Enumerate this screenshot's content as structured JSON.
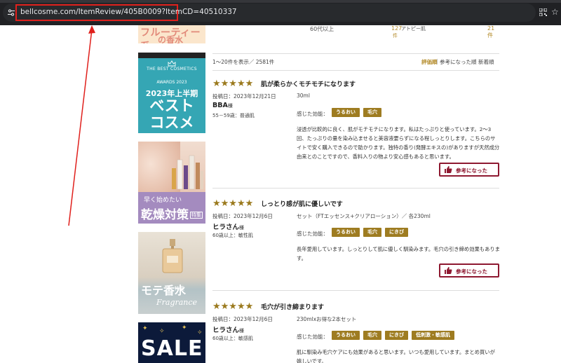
{
  "browser": {
    "url": "bellcosme.com/ItemReview/405B0009?ItemCD=40510337"
  },
  "banners": {
    "fruity": {
      "line1": "フルーティー系",
      "line2": "の香水"
    },
    "awards": {
      "line1": "THE BEST COSMETICS",
      "line2": "AWARDS 2023",
      "line3": "2023年上半期",
      "line4": "ベスト",
      "line5": "コスメ"
    },
    "dry": {
      "line1": "早く始めたい",
      "line2": "乾燥対策",
      "badge": "特集"
    },
    "perfume": {
      "line1": "モテ香水",
      "line2": "特集",
      "line3": "Fragrance"
    },
    "sale": {
      "line1": "SALE"
    }
  },
  "summary_row": {
    "age": "60代以上",
    "count1": "127",
    "count1_unit": "件",
    "skin": "アトピー肌",
    "count2": "21件"
  },
  "listing": {
    "pager": "1〜20件を表示／ 2581件",
    "sort_options": [
      "評価順",
      "参考になった順",
      "新着順"
    ],
    "active_sort": 0
  },
  "reviews": [
    {
      "stars": "★★★★★",
      "title": "肌が柔らかくモチモチになります",
      "date": "投稿日：2023年12月21日",
      "name": "BBA",
      "honorific": "様",
      "attributes": "55－59歳：普通肌",
      "product": "30ml",
      "effect_label": "感じた効能：",
      "tags": [
        "うるおい",
        "毛穴"
      ],
      "body": "浸透が比較的に良く、肌がモチモチになります。私はたっぷりと使っています。2〜3回、たっぷりの量を染み込ませると美容液要らずになる程しっとりします。こちらのサイトで安く購入できるので助かります。独特の香り(発酵エキスの)がありますが天然成分由来とのことですので、香料入りの物より安心感もあると思います。",
      "helpful": "参考になった"
    },
    {
      "stars": "★★★★★",
      "title": "しっとり感が肌に優しいです",
      "date": "投稿日：2023年12月6日",
      "name": "ヒラさん",
      "honorific": "様",
      "attributes": "60歳以上：敏性肌",
      "product": "セット（FTエッセンス+クリアローション）／ 各230ml",
      "effect_label": "感じた効能：",
      "tags": [
        "うるおい",
        "毛穴",
        "にきび"
      ],
      "body": "長年愛用しています。しっとりして肌に優しく馴染みます。毛穴の引き締め効果もあります。",
      "helpful": "参考になった"
    },
    {
      "stars": "★★★★★",
      "title": "毛穴が引き締まります",
      "date": "投稿日：2023年12月6日",
      "name": "ヒラさん",
      "honorific": "様",
      "attributes": "60歳以上：敏感肌",
      "product": "230mlxお得な2本セット",
      "effect_label": "感じた効能：",
      "tags": [
        "うるおい",
        "毛穴",
        "にきび",
        "低刺激・敏感肌"
      ],
      "body": "肌に馴染み毛穴ケアにも効果があると思います。いつも愛用しています。まとめ買いが嬉しいです。",
      "helpful": "参考になった"
    }
  ],
  "colors": {
    "gold": "#9e7c21",
    "helpful_border": "#8e1830",
    "annotation_red": "#e0201c"
  }
}
